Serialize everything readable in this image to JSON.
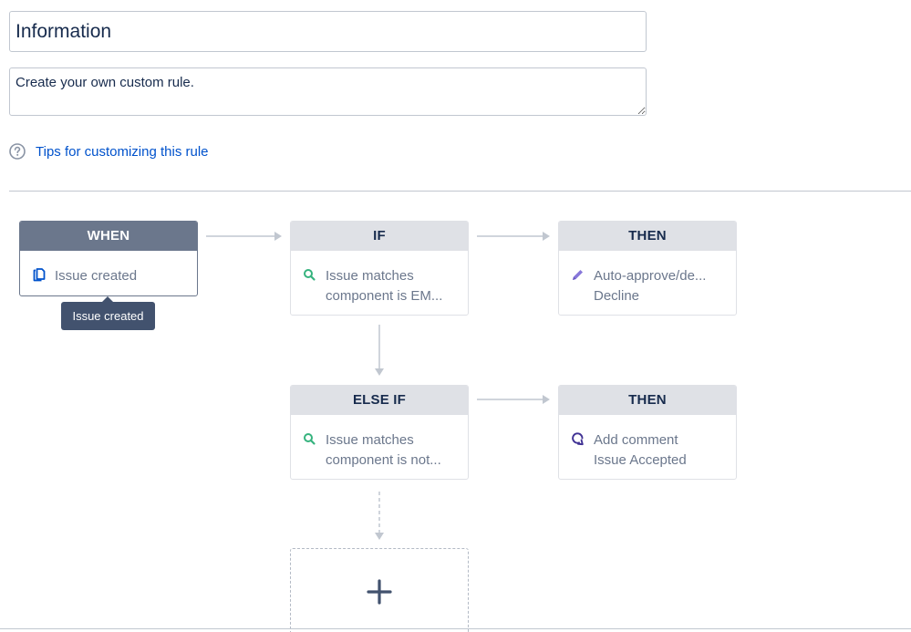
{
  "rule": {
    "name": "Information",
    "description": "Create your own custom rule."
  },
  "tips": {
    "link": "Tips for customizing this rule",
    "icon": "help-circle-icon"
  },
  "flow": {
    "when": {
      "header": "WHEN",
      "lines": [
        "Issue created"
      ],
      "icon": "issue-created-icon",
      "tooltip": "Issue created"
    },
    "if": {
      "header": "IF",
      "lines": [
        "Issue matches",
        "component is EM..."
      ],
      "icon": "search-icon"
    },
    "then_1": {
      "header": "THEN",
      "lines": [
        "Auto-approve/de...",
        "Decline"
      ],
      "icon": "pencil-icon"
    },
    "else_if": {
      "header": "ELSE IF",
      "lines": [
        "Issue matches",
        "component is not..."
      ],
      "icon": "search-icon"
    },
    "then_2": {
      "header": "THEN",
      "lines": [
        "Add comment",
        "Issue Accepted"
      ],
      "icon": "comment-icon"
    },
    "add_component": {
      "icon": "plus-icon"
    }
  },
  "colors": {
    "when_header": "#6b778c",
    "node_header": "#dfe1e6",
    "link": "#0052cc",
    "search_icon": "#36b37e",
    "pencil_icon": "#8777d9",
    "issue_icon": "#0052cc",
    "comment_icon": "#403294"
  }
}
